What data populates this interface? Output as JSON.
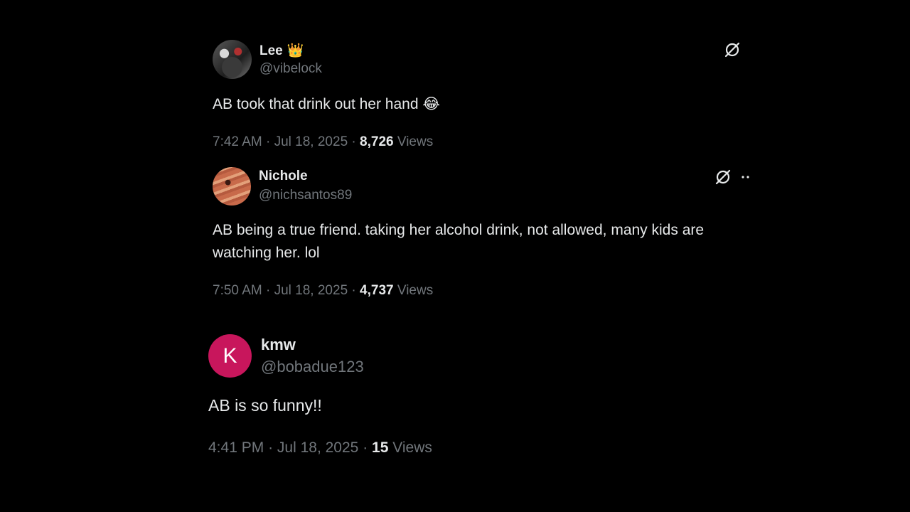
{
  "posts": [
    {
      "name": "Lee",
      "badge": "👑",
      "handle": "@vibelock",
      "text": "AB took that drink out her hand",
      "emoji": "😂",
      "time": "7:42 AM",
      "date": "Jul 18, 2025",
      "views_count": "8,726",
      "views_label": "Views",
      "icons": [
        "grok-icon"
      ]
    },
    {
      "name": "Nichole",
      "handle": "@nichsantos89",
      "text": "AB being a true friend. taking her alcohol drink, not allowed, many kids are watching her. lol",
      "time": "7:50 AM",
      "date": "Jul 18, 2025",
      "views_count": "4,737",
      "views_label": "Views",
      "icons": [
        "grok-icon",
        "more-icon"
      ]
    },
    {
      "name": "kmw",
      "avatar_initial": "K",
      "avatar_color": "#c8165c",
      "handle": "@bobadue123",
      "text": "AB is so funny!!",
      "time": "4:41 PM",
      "date": "Jul 18, 2025",
      "views_count": "15",
      "views_label": "Views"
    }
  ],
  "separator": "·",
  "colors": {
    "background": "#000000",
    "primary_text": "#e7e9ea",
    "secondary_text": "#71767b"
  }
}
